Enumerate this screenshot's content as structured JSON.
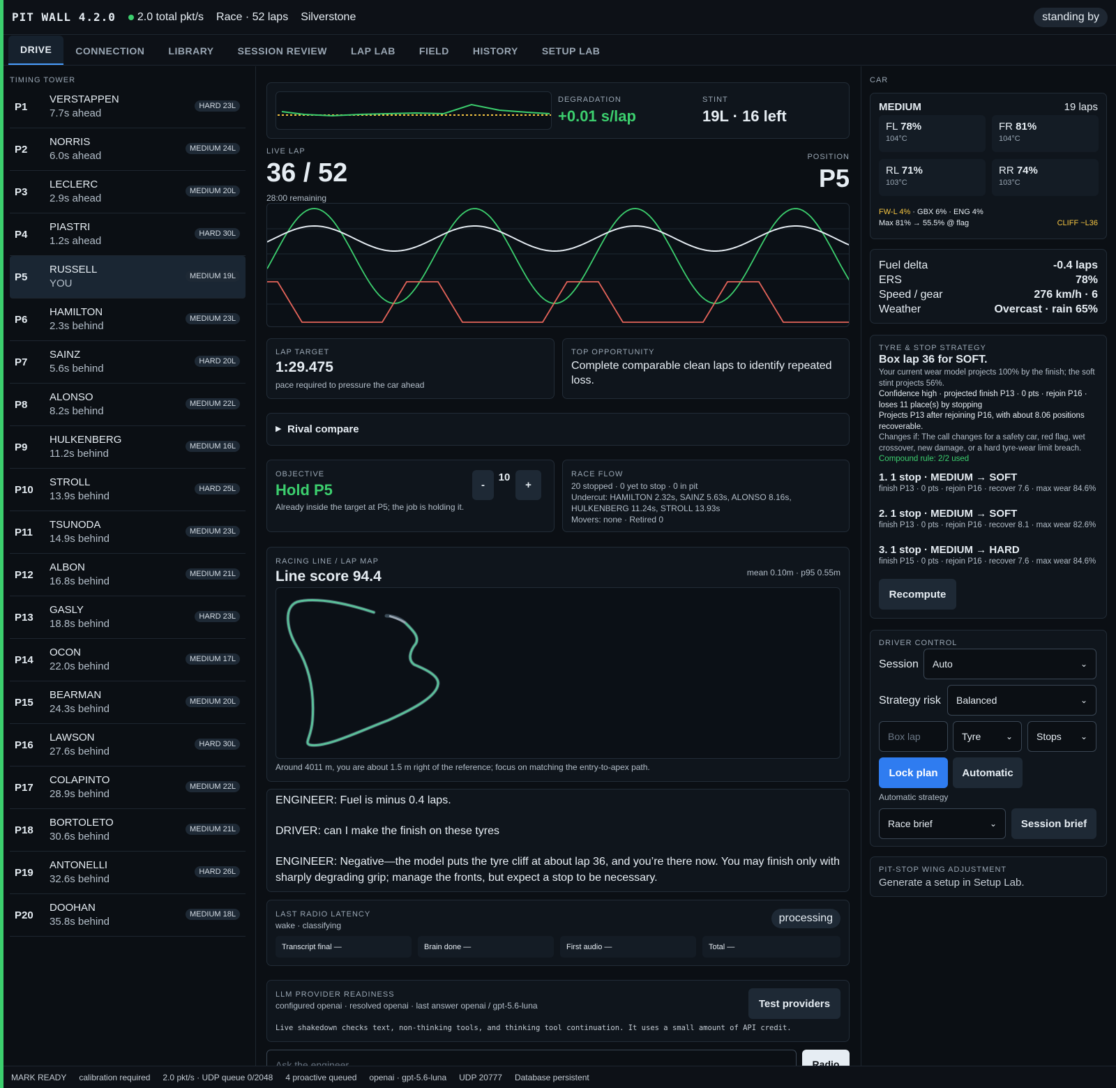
{
  "topbar": {
    "title": "PIT WALL 4.2.0",
    "packets": "2.0 total pkt/s",
    "session": "Race · 52 laps",
    "track": "Silverstone",
    "status": "standing by"
  },
  "tabs": [
    "DRIVE",
    "CONNECTION",
    "LIBRARY",
    "SESSION REVIEW",
    "LAP LAB",
    "FIELD",
    "HISTORY",
    "SETUP LAB"
  ],
  "tower": {
    "label": "TIMING TOWER",
    "rows": [
      {
        "pos": "P1",
        "name": "VERSTAPPEN",
        "gap": "7.7s ahead",
        "tyre": "HARD 23L"
      },
      {
        "pos": "P2",
        "name": "NORRIS",
        "gap": "6.0s ahead",
        "tyre": "MEDIUM 24L"
      },
      {
        "pos": "P3",
        "name": "LECLERC",
        "gap": "2.9s ahead",
        "tyre": "MEDIUM 20L"
      },
      {
        "pos": "P4",
        "name": "PIASTRI",
        "gap": "1.2s ahead",
        "tyre": "HARD 30L"
      },
      {
        "pos": "P5",
        "name": "RUSSELL",
        "gap": "YOU",
        "tyre": "MEDIUM 19L"
      },
      {
        "pos": "P6",
        "name": "HAMILTON",
        "gap": "2.3s behind",
        "tyre": "MEDIUM 23L"
      },
      {
        "pos": "P7",
        "name": "SAINZ",
        "gap": "5.6s behind",
        "tyre": "HARD 20L"
      },
      {
        "pos": "P8",
        "name": "ALONSO",
        "gap": "8.2s behind",
        "tyre": "MEDIUM 22L"
      },
      {
        "pos": "P9",
        "name": "HULKENBERG",
        "gap": "11.2s behind",
        "tyre": "MEDIUM 16L"
      },
      {
        "pos": "P10",
        "name": "STROLL",
        "gap": "13.9s behind",
        "tyre": "HARD 25L"
      },
      {
        "pos": "P11",
        "name": "TSUNODA",
        "gap": "14.9s behind",
        "tyre": "MEDIUM 23L"
      },
      {
        "pos": "P12",
        "name": "ALBON",
        "gap": "16.8s behind",
        "tyre": "MEDIUM 21L"
      },
      {
        "pos": "P13",
        "name": "GASLY",
        "gap": "18.8s behind",
        "tyre": "HARD 23L"
      },
      {
        "pos": "P14",
        "name": "OCON",
        "gap": "22.0s behind",
        "tyre": "MEDIUM 17L"
      },
      {
        "pos": "P15",
        "name": "BEARMAN",
        "gap": "24.3s behind",
        "tyre": "MEDIUM 20L"
      },
      {
        "pos": "P16",
        "name": "LAWSON",
        "gap": "27.6s behind",
        "tyre": "HARD 30L"
      },
      {
        "pos": "P17",
        "name": "COLAPINTO",
        "gap": "28.9s behind",
        "tyre": "MEDIUM 22L"
      },
      {
        "pos": "P18",
        "name": "BORTOLETO",
        "gap": "30.6s behind",
        "tyre": "MEDIUM 21L"
      },
      {
        "pos": "P19",
        "name": "ANTONELLI",
        "gap": "32.6s behind",
        "tyre": "HARD 26L"
      },
      {
        "pos": "P20",
        "name": "DOOHAN",
        "gap": "35.8s behind",
        "tyre": "MEDIUM 18L"
      }
    ]
  },
  "degradation": {
    "label": "DEGRADATION",
    "value": "+0.01 s/lap",
    "stint_label": "STINT",
    "stint_value": "19L · 16 left"
  },
  "live_lap": {
    "label": "LIVE LAP",
    "value": "36 / 52",
    "remaining": "28:00 remaining",
    "position_label": "POSITION",
    "position": "P5"
  },
  "lap_target": {
    "label": "LAP TARGET",
    "value": "1:29.475",
    "note": "pace required to pressure the car ahead"
  },
  "opportunity": {
    "label": "TOP OPPORTUNITY",
    "text": "Complete comparable clean laps to identify repeated loss."
  },
  "rival": {
    "label": "Rival compare"
  },
  "objective": {
    "label": "OBJECTIVE",
    "value": "Hold P5",
    "note": "Already inside the target at P5; the job is holding it.",
    "minus": "-",
    "count": "10",
    "plus": "+"
  },
  "race_flow": {
    "label": "RACE FLOW",
    "line1": "20 stopped · 0 yet to stop · 0 in pit",
    "line2": "Undercut: HAMILTON 2.32s, SAINZ 5.63s, ALONSO 8.16s, HULKENBERG 11.24s, STROLL 13.93s",
    "line3": "Movers: none · Retired 0"
  },
  "racing_line": {
    "label": "RACING LINE / LAP MAP",
    "score": "Line score 94.4",
    "stats": "mean 0.10m · p95 0.55m",
    "note": "Around 4011 m, you are about 1.5 m right of the reference; focus on matching the entry-to-apex path."
  },
  "radio": [
    "ENGINEER: Fuel is minus 0.4 laps.",
    "DRIVER: can I make the finish on these tyres",
    "ENGINEER: Negative—the model puts the tyre cliff at about lap 36, and you’re there now. You may finish only with sharply degrading grip; manage the fronts, but expect a stop to be necessary."
  ],
  "latency": {
    "label": "LAST RADIO LATENCY",
    "sub": "wake · classifying",
    "status": "processing",
    "cells": [
      "Transcript final —",
      "Brain done —",
      "First audio —",
      "Total —"
    ]
  },
  "llm": {
    "label": "LLM PROVIDER READINESS",
    "sub": "configured openai · resolved openai · last answer openai / gpt-5.6-luna",
    "button": "Test providers",
    "note": "Live shakedown checks text, non-thinking tools, and thinking tool continuation. It uses a small amount of API credit."
  },
  "ask": {
    "placeholder": "Ask the engineer",
    "button": "Radio"
  },
  "car": {
    "label": "CAR",
    "compound": "MEDIUM",
    "laps": "19 laps",
    "tyres": [
      {
        "corner": "FL",
        "wear": "78%",
        "temp": "104°C"
      },
      {
        "corner": "FR",
        "wear": "81%",
        "temp": "104°C"
      },
      {
        "corner": "RL",
        "wear": "71%",
        "temp": "103°C"
      },
      {
        "corner": "RR",
        "wear": "74%",
        "temp": "103°C"
      }
    ],
    "damage_warn": "FW-L 4%",
    "damage_rest": " · GBX 6% · ENG 4%",
    "max_line": "Max 81% → 55.5% @ flag",
    "cliff": "CLIFF ~L36"
  },
  "vitals": [
    {
      "k": "Fuel delta",
      "v": "-0.4 laps"
    },
    {
      "k": "ERS",
      "v": "78%"
    },
    {
      "k": "Speed / gear",
      "v": "276 km/h · 6"
    },
    {
      "k": "Weather",
      "v": "Overcast · rain 65%"
    }
  ],
  "strategy": {
    "label": "TYRE & STOP STRATEGY",
    "headline": "Box lap 36 for SOFT.",
    "p1": "Your current wear model projects 100% by the finish; the soft stint projects 56%.",
    "p2": "Confidence high · projected finish P13 · 0 pts · rejoin P16 · loses 11 place(s) by stopping",
    "p3": "Projects P13 after rejoining P16, with about 8.06 positions recoverable.",
    "p4": "Changes if: The call changes for a safety car, red flag, wet crossover, new damage, or a hard tyre-wear limit breach.",
    "rule": "Compound rule: 2/2 used",
    "options": [
      {
        "title": "1. 1 stop · MEDIUM → SOFT",
        "detail": "finish P13 · 0 pts · rejoin P16 · recover 7.6 · max wear 84.6%"
      },
      {
        "title": "2. 1 stop · MEDIUM → SOFT",
        "detail": "finish P13 · 0 pts · rejoin P16 · recover 8.1 · max wear 82.6%"
      },
      {
        "title": "3. 1 stop · MEDIUM → HARD",
        "detail": "finish P15 · 0 pts · rejoin P16 · recover 7.6 · max wear 84.6%"
      }
    ],
    "button": "Recompute"
  },
  "driver_control": {
    "label": "DRIVER CONTROL",
    "session_label": "Session",
    "session_value": "Auto",
    "risk_label": "Strategy risk",
    "risk_value": "Balanced",
    "boxlap_placeholder": "Box lap",
    "tyre_value": "Tyre",
    "stops_value": "Stops",
    "lock": "Lock plan",
    "automatic": "Automatic",
    "auto_note": "Automatic strategy",
    "brief_value": "Race brief",
    "brief_button": "Session brief"
  },
  "wing": {
    "label": "PIT-STOP WING ADJUSTMENT",
    "text": "Generate a setup in Setup Lab."
  },
  "statusbar": [
    "MARK READY",
    "calibration required",
    "2.0 pkt/s · UDP queue 0/2048",
    "4 proactive queued",
    "openai · gpt-5.6-luna",
    "UDP 20777",
    "Database persistent"
  ],
  "colors": {
    "accent": "#3ccf6e",
    "blue": "#2f7cf0",
    "warn": "#f5c542",
    "red": "#e5645a"
  }
}
